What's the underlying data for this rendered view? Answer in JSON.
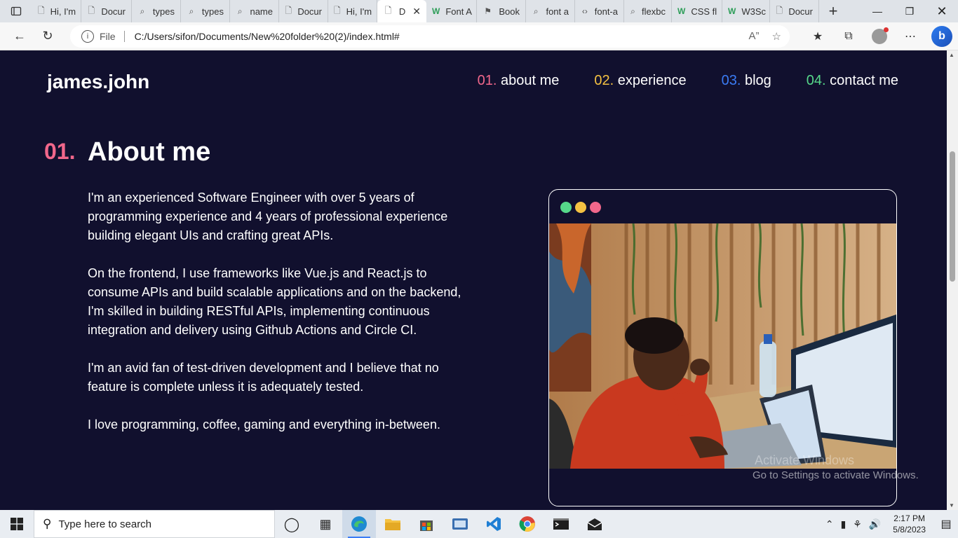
{
  "browser": {
    "tabs": [
      {
        "icon": "page-icon",
        "label": "Hi, I'm"
      },
      {
        "icon": "page-icon",
        "label": "Docur"
      },
      {
        "icon": "search-icon",
        "label": "types"
      },
      {
        "icon": "search-icon",
        "label": "types"
      },
      {
        "icon": "search-icon",
        "label": "name"
      },
      {
        "icon": "page-icon",
        "label": "Docur"
      },
      {
        "icon": "page-icon",
        "label": "Hi, I'm"
      },
      {
        "icon": "page-icon",
        "label": "D",
        "active": true
      },
      {
        "icon": "w3-icon",
        "label": "Font A"
      },
      {
        "icon": "flag-icon",
        "label": "Book"
      },
      {
        "icon": "search-icon",
        "label": "font a"
      },
      {
        "icon": "code-icon",
        "label": "font-a"
      },
      {
        "icon": "search-icon",
        "label": "flexbc"
      },
      {
        "icon": "w3-icon",
        "label": "CSS fl"
      },
      {
        "icon": "w3-icon",
        "label": "W3Sc"
      },
      {
        "icon": "page-icon",
        "label": "Docur"
      }
    ],
    "address": {
      "scheme_label": "File",
      "url": "C:/Users/sifon/Documents/New%20folder%20(2)/index.html#"
    }
  },
  "site": {
    "brand": "james.john",
    "nav": [
      {
        "num": "01.",
        "label": "about me",
        "color": "#f1678b"
      },
      {
        "num": "02.",
        "label": "experience",
        "color": "#f4c142"
      },
      {
        "num": "03.",
        "label": "blog",
        "color": "#3b7cf5"
      },
      {
        "num": "04.",
        "label": "contact me",
        "color": "#56d88a"
      }
    ],
    "section": {
      "number": "01.",
      "title": "About me"
    },
    "paragraphs": [
      "I'm an experienced Software Engineer with over 5 years of programming experience and 4 years of professional experience building elegant UIs and crafting great APIs.",
      "On the frontend, I use frameworks like Vue.js and React.js to consume APIs and build scalable applications and on the backend, I'm skilled in building RESTful APIs, implementing continuous integration and delivery using Github Actions and Circle CI.",
      "I'm an avid fan of test-driven development and I believe that no feature is complete unless it is adequately tested.",
      "I love programming, coffee, gaming and everything in-between."
    ]
  },
  "watermark": {
    "line1": "Activate Windows",
    "line2": "Go to Settings to activate Windows."
  },
  "taskbar": {
    "search_placeholder": "Type here to search",
    "time": "2:17 PM",
    "date": "5/8/2023"
  },
  "colors": {
    "page_bg": "#11102e",
    "pink": "#f1678b",
    "yellow": "#f4c142",
    "blue": "#3b7cf5",
    "green": "#56d88a"
  }
}
